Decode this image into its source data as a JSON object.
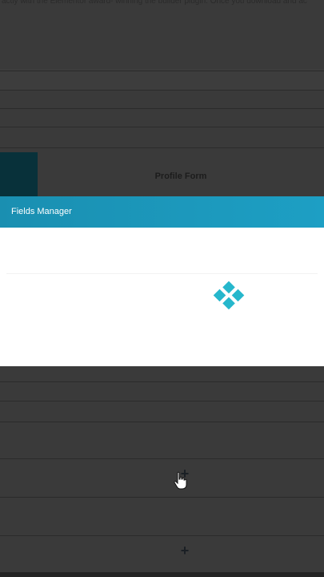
{
  "background": {
    "top_text": "actly with the Elementor award- winning the builder plugin. Once you download and ac",
    "form_title": "Profile Form"
  },
  "modal": {
    "title": "Fields Manager",
    "loader_icon": "spinner-icon"
  },
  "icons": {
    "add_icon": "plus-icon",
    "cursor_icon": "hand-cursor-icon"
  },
  "colors": {
    "overlay": "#3a3a3a",
    "header_accent": "#1a8fb1",
    "loader": "#26b7cc",
    "teal_block": "#08313a"
  }
}
